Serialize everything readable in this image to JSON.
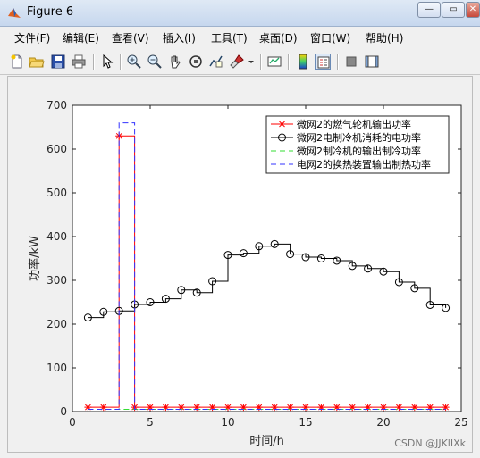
{
  "window": {
    "title": "Figure 6",
    "minimize_label": "—",
    "maximize_label": "▭",
    "close_label": "✕"
  },
  "menu": [
    "文件(F)",
    "编辑(E)",
    "查看(V)",
    "插入(I)",
    "工具(T)",
    "桌面(D)",
    "窗口(W)",
    "帮助(H)"
  ],
  "toolbar_icons": [
    "new-figure-icon",
    "open-folder-icon",
    "save-icon",
    "print-icon",
    "pointer-icon",
    "zoom-in-icon",
    "zoom-out-icon",
    "pan-hand-icon",
    "rotate-3d-icon",
    "data-cursor-icon",
    "brush-icon",
    "dropdown-arrow-icon",
    "link-plot-icon",
    "colorbar-icon",
    "legend-icon",
    "hide-plot-tools-icon",
    "show-plot-tools-icon"
  ],
  "watermark": "CSDN @JJKlIXk",
  "chart_data": {
    "type": "line",
    "xlabel": "时间/h",
    "ylabel": "功率/kW",
    "xlim": [
      0,
      25
    ],
    "ylim": [
      0,
      700
    ],
    "xticks": [
      "0",
      "5",
      "10",
      "15",
      "20",
      "25"
    ],
    "yticks": [
      "0",
      "100",
      "200",
      "300",
      "400",
      "500",
      "600",
      "700"
    ],
    "legend_position": "top-right",
    "x": [
      1,
      2,
      3,
      4,
      5,
      6,
      7,
      8,
      9,
      10,
      11,
      12,
      13,
      14,
      15,
      16,
      17,
      18,
      19,
      20,
      21,
      22,
      23,
      24
    ],
    "series": [
      {
        "name": "微网2的燃气轮机输出功率",
        "color": "#ff0000",
        "style": "solid",
        "marker": "star",
        "values": [
          10,
          10,
          630,
          10,
          10,
          10,
          10,
          10,
          10,
          10,
          10,
          10,
          10,
          10,
          10,
          10,
          10,
          10,
          10,
          10,
          10,
          10,
          10,
          10
        ]
      },
      {
        "name": "微网2电制冷机消耗的电功率",
        "color": "#000000",
        "style": "solid",
        "marker": "circle",
        "values": [
          215,
          228,
          230,
          245,
          250,
          258,
          278,
          272,
          298,
          358,
          362,
          378,
          383,
          360,
          353,
          350,
          345,
          333,
          327,
          320,
          296,
          282,
          244,
          237
        ]
      },
      {
        "name": "微网2制冷机的输出制冷功率",
        "color": "#33dd33",
        "style": "dashed",
        "marker": "none",
        "values": [
          5,
          5,
          5,
          5,
          5,
          5,
          5,
          5,
          5,
          5,
          5,
          5,
          5,
          5,
          5,
          5,
          5,
          5,
          5,
          5,
          5,
          5,
          5,
          5
        ]
      },
      {
        "name": "电网2的换热装置输出制热功率",
        "color": "#3333ff",
        "style": "dashed",
        "marker": "none",
        "values": [
          5,
          5,
          660,
          5,
          5,
          5,
          5,
          5,
          5,
          5,
          5,
          5,
          5,
          5,
          5,
          5,
          5,
          5,
          5,
          5,
          5,
          5,
          5,
          5
        ]
      }
    ]
  }
}
